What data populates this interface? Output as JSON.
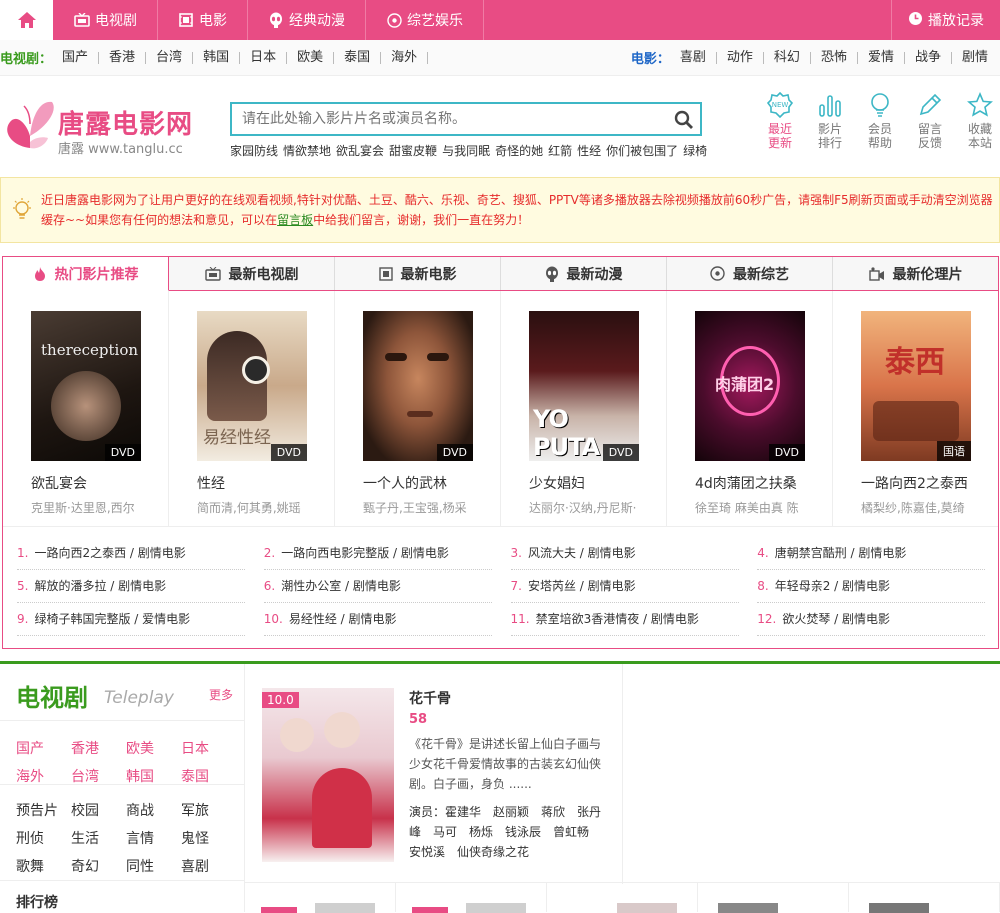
{
  "topnav": {
    "items": [
      {
        "label": "电视剧",
        "icon": "tv-icon"
      },
      {
        "label": "电影",
        "icon": "film-icon"
      },
      {
        "label": "经典动漫",
        "icon": "alien-icon"
      },
      {
        "label": "综艺娱乐",
        "icon": "disc-icon"
      }
    ],
    "history_label": "播放记录"
  },
  "subnav": {
    "tv_title": "电视剧：",
    "tv_items": [
      "国产",
      "香港",
      "台湾",
      "韩国",
      "日本",
      "欧美",
      "泰国",
      "海外"
    ],
    "movie_title": "电影：",
    "movie_items": [
      "喜剧",
      "动作",
      "科幻",
      "恐怖",
      "爱情",
      "战争",
      "剧情"
    ]
  },
  "logo": {
    "name": "唐露电影网",
    "url": "唐露 www.tanglu.cc"
  },
  "search": {
    "placeholder": "请在此处输入影片片名或演员名称。",
    "hotwords": [
      "家园防线",
      "情欲禁地",
      "欲乱宴会",
      "甜蜜皮鞭",
      "与我同眠",
      "奇怪的她",
      "红箭",
      "性经",
      "你们被包围了",
      "绿椅"
    ]
  },
  "header_icons": [
    {
      "line1": "最近",
      "line2": "更新",
      "icon": "new-badge-icon",
      "active": true
    },
    {
      "line1": "影片",
      "line2": "排行",
      "icon": "bar-chart-icon",
      "active": false
    },
    {
      "line1": "会员",
      "line2": "帮助",
      "icon": "bulb-icon",
      "active": false
    },
    {
      "line1": "留言",
      "line2": "反馈",
      "icon": "pencil-icon",
      "active": false
    },
    {
      "line1": "收藏",
      "line2": "本站",
      "icon": "star-icon",
      "active": false
    }
  ],
  "notice": {
    "text_before": "近日唐露电影网为了让用户更好的在线观看视频,特针对优酷、土豆、酷六、乐视、奇艺、搜狐、PPTV等诸多播放器去除视频播放前60秒广告，请强制F5刷新页面或手动清空浏览器缓存~~如果您有任何的想法和意见，可以在",
    "link": "留言板",
    "text_after": "中给我们留言，谢谢，我们一直在努力！"
  },
  "tabs": [
    "热门影片推荐",
    "最新电视剧",
    "最新电影",
    "最新动漫",
    "最新综艺",
    "最新伦理片"
  ],
  "posters": [
    {
      "title": "欲乱宴会",
      "actors": "克里斯·达里恩,西尔",
      "tag": "DVD",
      "poster_text": "thereception"
    },
    {
      "title": "性经",
      "actors": "简而清,何其勇,姚瑶",
      "tag": "DVD",
      "poster_text": "易经性经"
    },
    {
      "title": "一个人的武林",
      "actors": "甄子丹,王宝强,杨采",
      "tag": "DVD",
      "poster_text": ""
    },
    {
      "title": "少女娼妇",
      "actors": "达丽尔·汉纳,丹尼斯·",
      "tag": "DVD",
      "poster_text": "YO PUTA"
    },
    {
      "title": "4d肉蒲团之扶桑",
      "actors": "徐至琦 麻美由真 陈",
      "tag": "DVD",
      "poster_text": "肉蒲团2"
    },
    {
      "title": "一路向西2之泰西",
      "actors": "橘梨纱,陈嘉佳,莫绮",
      "tag": "国语",
      "poster_text": "泰西"
    }
  ],
  "toplist": [
    {
      "num": "1.",
      "title": "一路向西2之泰西",
      "cat": "剧情电影"
    },
    {
      "num": "2.",
      "title": "一路向西电影完整版",
      "cat": "剧情电影"
    },
    {
      "num": "3.",
      "title": "风流大夫",
      "cat": "剧情电影"
    },
    {
      "num": "4.",
      "title": "唐朝禁宫酷刑",
      "cat": "剧情电影"
    },
    {
      "num": "5.",
      "title": "解放的潘多拉",
      "cat": "剧情电影"
    },
    {
      "num": "6.",
      "title": "潮性办公室",
      "cat": "剧情电影"
    },
    {
      "num": "7.",
      "title": "安塔芮丝",
      "cat": "剧情电影"
    },
    {
      "num": "8.",
      "title": "年轻母亲2",
      "cat": "剧情电影"
    },
    {
      "num": "9.",
      "title": "绿椅子韩国完整版",
      "cat": "爱情电影"
    },
    {
      "num": "10.",
      "title": "易经性经",
      "cat": "剧情电影"
    },
    {
      "num": "11.",
      "title": "禁室培欲3香港情夜",
      "cat": "剧情电影"
    },
    {
      "num": "12.",
      "title": "欲火焚琴",
      "cat": "剧情电影"
    }
  ],
  "tvsection": {
    "title": "电视剧",
    "subtitle": "Teleplay",
    "more": "更多",
    "regions": [
      "国产",
      "香港",
      "欧美",
      "日本",
      "海外",
      "台湾",
      "韩国",
      "泰国"
    ],
    "genres": [
      "预告片",
      "校园",
      "商战",
      "军旅",
      "刑侦",
      "生活",
      "言情",
      "鬼怪",
      "歌舞",
      "奇幻",
      "同性",
      "喜剧"
    ],
    "rank_title": "排行榜",
    "featured": {
      "score_tag": "10.0",
      "title": "花千骨",
      "score": "58",
      "desc": "《花千骨》是讲述长留上仙白子画与少女花千骨爱情故事的古装玄幻仙侠剧。白子画，身负 ......",
      "cast_label": "演员：",
      "cast": "霍建华　赵丽颖　蒋欣　张丹峰　马可　杨烁　钱泳辰　曾虹畅　安悦溪　仙侠奇缘之花"
    }
  },
  "colors": {
    "brand": "#e84c84",
    "green": "#3a9b1e",
    "blue": "#1f67c7",
    "search_border": "#3db7c6"
  }
}
